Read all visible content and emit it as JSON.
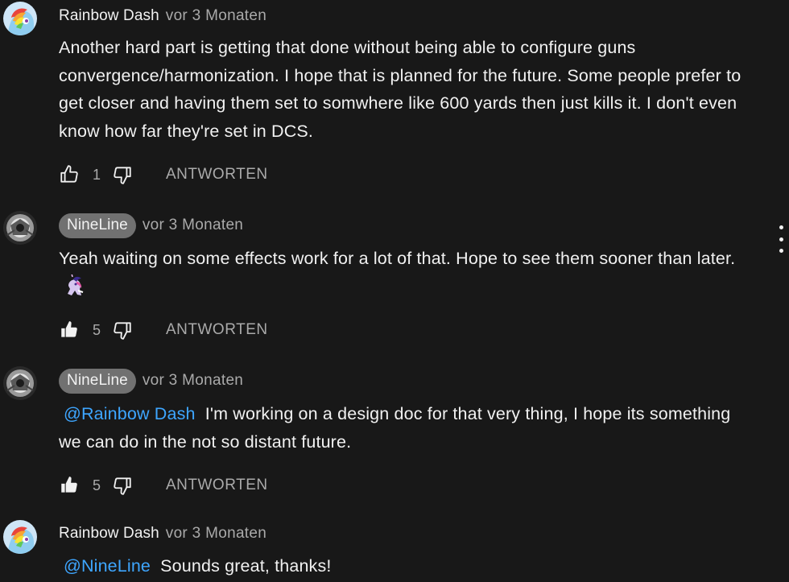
{
  "comments": [
    {
      "author": "Rainbow Dash",
      "time": "vor 3 Monaten",
      "text": "Another hard part is getting that done without being able to configure guns convergence/harmonization. I hope that is planned for the future. Some people prefer to get closer and having them set to somwhere like 600 yards then just kills it. I don't even know how far they're set in DCS.",
      "likes": "1",
      "reply_label": "ANTWORTEN"
    },
    {
      "author": "NineLine",
      "time": "vor 3 Monaten",
      "text": "Yeah waiting on some effects work for a lot of that. Hope to see them sooner than later.",
      "likes": "5",
      "reply_label": "ANTWORTEN"
    },
    {
      "author": "NineLine",
      "time": "vor 3 Monaten",
      "mention": "@Rainbow Dash",
      "text": "I'm working on a design doc for that very thing, I hope its something we can do in the not so distant future.",
      "likes": "5",
      "reply_label": "ANTWORTEN"
    },
    {
      "author": "Rainbow Dash",
      "time": "vor 3 Monaten",
      "mention": "@NineLine",
      "text": "Sounds great, thanks!"
    }
  ],
  "icons": {
    "like": "thumbs-up-icon",
    "dislike": "thumbs-down-icon",
    "more": "more-vertical-icon"
  },
  "colors": {
    "background": "#181818",
    "text": "#f1f1f1",
    "secondary": "#aaaaaa",
    "mention": "#3ea6ff",
    "author_pill": "#717171"
  }
}
